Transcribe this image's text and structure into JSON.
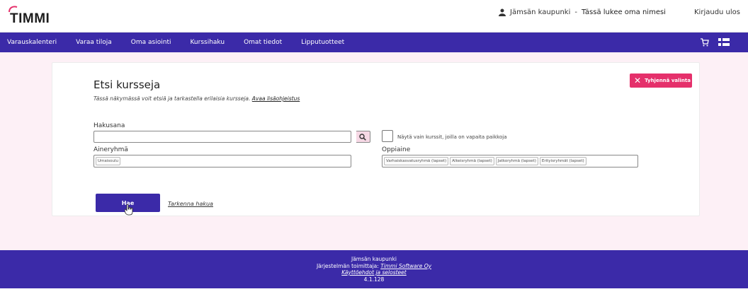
{
  "header": {
    "logo_text": "TIMMI",
    "organization": "Jämsän kaupunki",
    "separator": "-",
    "user_name": "Tässä lukee oma nimesi",
    "logout": "Kirjaudu ulos"
  },
  "nav": {
    "items": [
      "Varauskalenteri",
      "Varaa tiloja",
      "Oma asiointi",
      "Kurssihaku",
      "Omat tiedot",
      "Lipputuotteet"
    ]
  },
  "main": {
    "title": "Etsi kursseja",
    "subtitle": "Tässä näkymässä voit etsiä ja tarkastella erilaisia kursseja.",
    "help_link": "Avaa lisäohjeistus",
    "clear_button": "Tyhjennä valinta",
    "search_label": "Hakusana",
    "search_value": "",
    "checkbox_label": "Näytä vain kurssit, joilla on vapaita paikkoja",
    "subject_group_label": "Aineryhmä",
    "subject_group_chips": [
      "Umaisoulu"
    ],
    "subject_label": "Oppiaine",
    "subject_chips": [
      "Varhaiskasvatusryhmä (lapset)",
      "Alkeisryhmä (lapset)",
      "Jatkoryhmä (lapset)",
      "Erityisryhmät (lapset)"
    ],
    "search_button": "Hae",
    "refine_link": "Tarkenna hakua"
  },
  "footer": {
    "organization": "Jämsän kaupunki",
    "supplier_prefix": "Järjestelmän toimittaja:",
    "supplier": "Timmi Software Oy",
    "terms": "Käyttöehdot ja selosteet",
    "version": "4.1.128"
  },
  "colors": {
    "brand": "#3b2aa8",
    "accent": "#e5306b",
    "background_pink": "#fdf0f6"
  },
  "icons": {
    "user": "user-icon",
    "cart": "cart-icon",
    "menu": "list-menu-icon",
    "search": "search-icon",
    "clear": "close-icon"
  }
}
